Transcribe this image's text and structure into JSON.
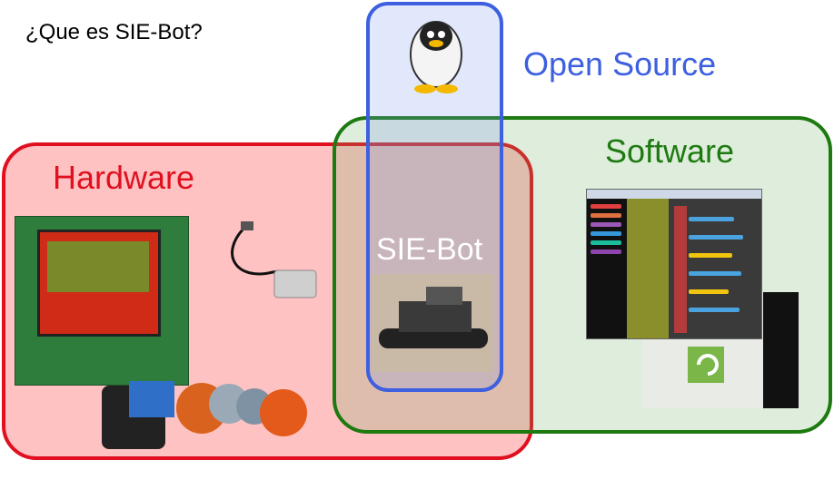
{
  "title": "¿Que es SIE-Bot?",
  "regions": {
    "open_source": {
      "label": "Open Source",
      "color": "#3d5fe0"
    },
    "software": {
      "label": "Software",
      "color": "#1d7a10"
    },
    "hardware": {
      "label": "Hardware",
      "color": "#e01020"
    },
    "intersection": {
      "label": "SIE-Bot",
      "color": "#ffffff"
    }
  }
}
